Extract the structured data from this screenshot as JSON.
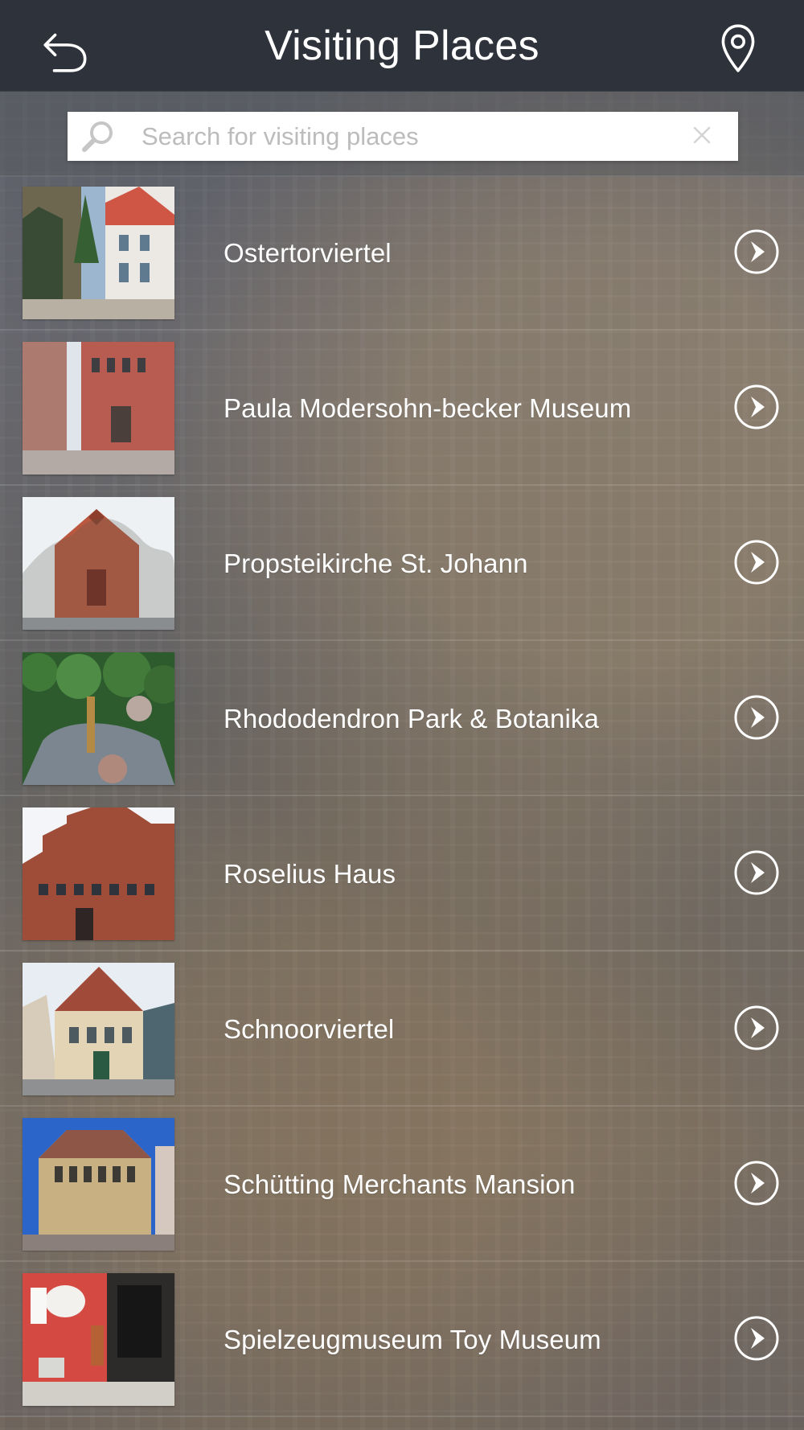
{
  "header": {
    "title": "Visiting Places",
    "back_icon": "back-arrow-icon",
    "location_icon": "location-pin-icon"
  },
  "search": {
    "placeholder": "Search for visiting places",
    "value": "",
    "search_icon": "search-icon",
    "clear_icon": "clear-icon"
  },
  "places": [
    {
      "label": "Ostertorviertel",
      "thumb_icon": "street-houses-photo",
      "action_icon": "chevron-right-icon"
    },
    {
      "label": "Paula Modersohn-becker Museum",
      "thumb_icon": "museum-building-photo",
      "action_icon": "chevron-right-icon"
    },
    {
      "label": "Propsteikirche St. Johann",
      "thumb_icon": "church-photo",
      "action_icon": "chevron-right-icon"
    },
    {
      "label": "Rhododendron Park & Botanika",
      "thumb_icon": "garden-photo",
      "action_icon": "chevron-right-icon"
    },
    {
      "label": "Roselius Haus",
      "thumb_icon": "brick-house-photo",
      "action_icon": "chevron-right-icon"
    },
    {
      "label": "Schnoorviertel",
      "thumb_icon": "old-town-house-photo",
      "action_icon": "chevron-right-icon"
    },
    {
      "label": "Schütting Merchants Mansion",
      "thumb_icon": "merchant-mansion-photo",
      "action_icon": "chevron-right-icon"
    },
    {
      "label": "Spielzeugmuseum Toy Museum",
      "thumb_icon": "toy-museum-photo",
      "action_icon": "chevron-right-icon"
    }
  ],
  "colors": {
    "topbar": "#2e323a",
    "text": "#ffffff",
    "search_bg": "#ffffff",
    "placeholder": "#bcbcbc"
  }
}
